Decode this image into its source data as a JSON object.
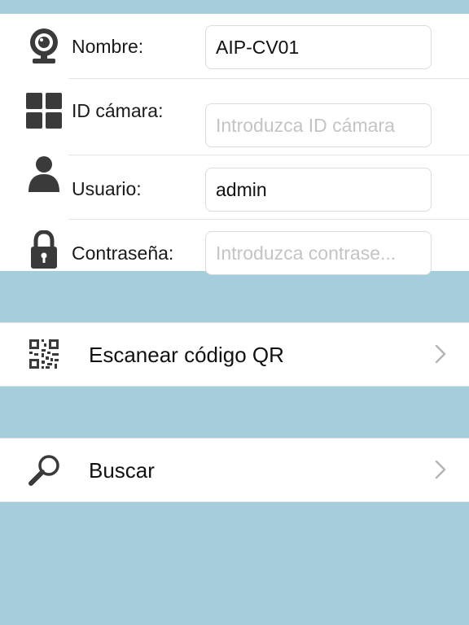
{
  "form": {
    "fields": [
      {
        "label": "Nombre:",
        "value": "AIP-CV01",
        "placeholder": "",
        "icon": "webcam-icon"
      },
      {
        "label": "ID cámara:",
        "value": "",
        "placeholder": "Introduzca ID cámara",
        "icon": "grid-icon"
      },
      {
        "label": "Usuario:",
        "value": "admin",
        "placeholder": "",
        "icon": "user-icon"
      },
      {
        "label": "Contraseña:",
        "value": "",
        "placeholder": "Introduzca contrase...",
        "icon": "lock-icon"
      }
    ]
  },
  "menu": {
    "scan_qr": {
      "label": "Escanear código QR",
      "icon": "qr-code-icon"
    },
    "search": {
      "label": "Buscar",
      "icon": "magnifier-icon"
    }
  },
  "colors": {
    "background": "#a5cddb",
    "panel": "#ffffff",
    "icon": "#3a3a3a"
  }
}
